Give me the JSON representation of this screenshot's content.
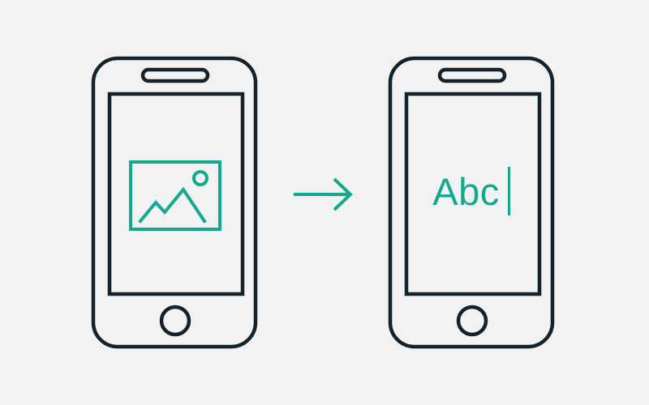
{
  "colors": {
    "background": "#f2f2f2",
    "outline": "#12232e",
    "accent": "#14a88f"
  },
  "diagram": {
    "source_phone": {
      "content_icon": "image-icon"
    },
    "transition_icon": "arrow-right-icon",
    "result_phone": {
      "text": "Abc",
      "cursor_icon": "text-cursor-icon"
    }
  }
}
